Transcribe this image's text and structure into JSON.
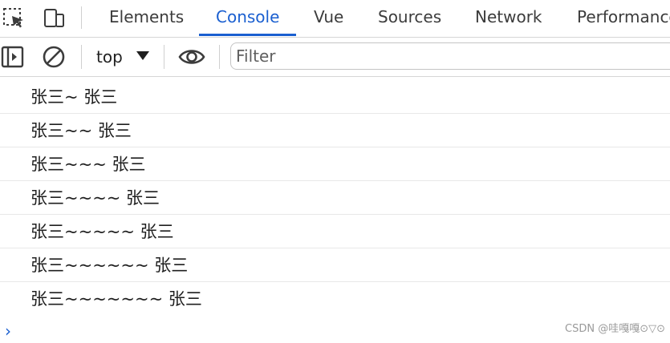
{
  "tabs": [
    {
      "label": "Elements",
      "active": false
    },
    {
      "label": "Console",
      "active": true
    },
    {
      "label": "Vue",
      "active": false
    },
    {
      "label": "Sources",
      "active": false
    },
    {
      "label": "Network",
      "active": false
    },
    {
      "label": "Performance",
      "active": false
    }
  ],
  "toolbar": {
    "context": "top",
    "filter_placeholder": "Filter"
  },
  "console_messages": [
    "张三~ 张三",
    "张三~~ 张三",
    "张三~~~ 张三",
    "张三~~~~ 张三",
    "张三~~~~~ 张三",
    "张三~~~~~~ 张三",
    "张三~~~~~~~ 张三"
  ],
  "prompt_symbol": "›",
  "watermark": "CSDN @哇嘎嘎⊙▽⊙",
  "colors": {
    "accent": "#1a5fd0",
    "text": "#1f1f1f",
    "divider": "#e8e8e8"
  },
  "icons": {
    "inspect": "inspect-element-icon",
    "device": "device-toolbar-icon",
    "sidebar": "sidebar-toggle-icon",
    "clear": "clear-console-icon",
    "live_expression": "eye-icon"
  }
}
